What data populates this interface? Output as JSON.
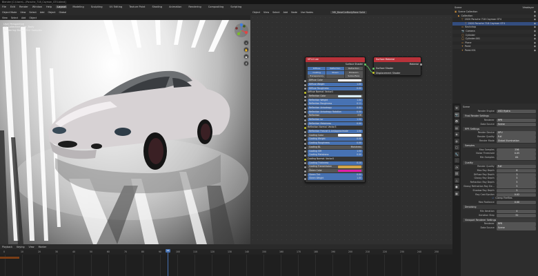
{
  "window": {
    "title": "Blender [C:\\Users\\...\\Porsche_718_Cayman_GT4.blend]"
  },
  "menu": {
    "items": [
      "File",
      "Edit",
      "Render",
      "Window",
      "Help"
    ],
    "workspaces": [
      "Layout",
      "Modeling",
      "Sculpting",
      "UV Editing",
      "Texture Paint",
      "Shading",
      "Animation",
      "Rendering",
      "Compositing",
      "Scripting"
    ],
    "active_workspace": "Layout"
  },
  "viewport": {
    "header": [
      "Object Mode",
      "View",
      "Select",
      "Add",
      "Object",
      "Global"
    ],
    "subheader": [
      "View",
      "Select",
      "Add",
      "Object"
    ],
    "info": [
      "User Perspective",
      "(0) Collection | Car_Body",
      "Rendering Done / 512 Samples"
    ],
    "gizmo_axes": [
      "X",
      "Y",
      "Z"
    ]
  },
  "node_editor": {
    "header": [
      "Object",
      "View",
      "Select",
      "Add",
      "Node",
      "Use Nodes"
    ],
    "material_name": "MK_BaseCarBodyBase Solid"
  },
  "mtlx_node": {
    "title": "MTLX Lee",
    "output": "Surface Shader",
    "btn_rows": [
      [
        "Diffuse",
        "Reflection",
        "Refraction"
      ],
      [
        "Coating",
        "Sheen",
        "Emission"
      ],
      [
        "Transparency",
        "",
        "Subsurface"
      ]
    ],
    "fields": [
      {
        "label": "Diffuse Color",
        "value": "",
        "kind": "color",
        "color": "#ffffff"
      },
      {
        "label": "Diffuse Weight",
        "value": "1.00"
      },
      {
        "label": "Diffuse Roughness",
        "value": "0.00"
      },
      {
        "label": "Diffuse Normal: Vector3",
        "value": "",
        "kind": "label"
      },
      {
        "label": "Reflection Color",
        "value": "",
        "kind": "color",
        "color": "#d9ecf5"
      },
      {
        "label": "Reflection Weight",
        "value": "1.00"
      },
      {
        "label": "Reflection Roughness",
        "value": "0.11"
      },
      {
        "label": "Reflection Anisotropy",
        "value": "0.00"
      },
      {
        "label": "Reflection Anisotropy Rotation",
        "value": "0.00"
      },
      {
        "label": "Reflection",
        "value": "IOR",
        "kind": "enum"
      },
      {
        "label": "Reflection Ior",
        "value": "1.50"
      },
      {
        "label": "Reflection Metalness",
        "value": "0.00"
      },
      {
        "label": "Reflection Normal: Vector3",
        "value": "",
        "kind": "label"
      },
      {
        "label": "Reflection Fresnel & Air/Approximate",
        "value": "1.50"
      },
      {
        "label": "Coating Color",
        "value": "",
        "kind": "color",
        "color": "#ffffff"
      },
      {
        "label": "Coating Weight",
        "value": "0.00"
      },
      {
        "label": "Coating Roughness",
        "value": "0.00"
      },
      {
        "label": "Coating BL",
        "value": "Moistness",
        "kind": "enum"
      },
      {
        "label": "Coating IOR",
        "value": "1.50"
      },
      {
        "label": "Coating Metalness",
        "value": "0.00"
      },
      {
        "label": "Coating Normal: Vector3",
        "value": "",
        "kind": "label"
      },
      {
        "label": "Coating Thickness",
        "value": "0.10"
      },
      {
        "label": "Coating Transmission Color",
        "value": "",
        "kind": "color",
        "color": "#d4a548"
      },
      {
        "label": "Sheen Color",
        "value": "",
        "kind": "color",
        "color": "#e21ca8"
      },
      {
        "label": "Sheen Tint",
        "value": "0.00"
      },
      {
        "label": "Sheen Weight",
        "value": "1.00"
      }
    ]
  },
  "surface_node": {
    "title": "Surface Material",
    "output": "Material",
    "inputs": [
      "Surface Shader",
      "Displacement Shader"
    ]
  },
  "outliner": {
    "header": [
      "Scene",
      "Viewlayer"
    ],
    "rows": [
      {
        "label": "Scene Collection",
        "depth": 0
      },
      {
        "label": "Collection",
        "depth": 1
      },
      {
        "label": "2020 Porsche 718 Cayman GT4",
        "depth": 2
      },
      {
        "label": "2020 Porsche 718 Cayman GT4",
        "depth": 3,
        "selected": true
      },
      {
        "label": "Backdrop",
        "depth": 2
      },
      {
        "label": "Camera",
        "depth": 2
      },
      {
        "label": "Cylinder",
        "depth": 2
      },
      {
        "label": "Cylinder.001",
        "depth": 2
      },
      {
        "label": "Plane",
        "depth": 2
      },
      {
        "label": "Point",
        "depth": 2
      },
      {
        "label": "Point.001",
        "depth": 2
      }
    ]
  },
  "properties": {
    "tabs": [
      "tool",
      "render",
      "output",
      "view-layer",
      "scene",
      "world",
      "object",
      "modifier",
      "particles",
      "physics",
      "constraints",
      "data",
      "material",
      "texture"
    ],
    "scene_label": "Scene",
    "render_engine": {
      "label": "Render Engine",
      "value": "USD Hydra"
    },
    "sections": [
      {
        "title": "Final Render Settings",
        "rows": [
          {
            "label": "Renderer",
            "value": "RPR"
          },
          {
            "label": "Data Source",
            "value": "Scene"
          }
        ]
      },
      {
        "title": "RPR Settings",
        "rows": [
          {
            "label": "Render Device",
            "value": "GPU"
          },
          {
            "label": "Render Quality",
            "value": "Full"
          },
          {
            "label": "Render Mode",
            "value": "Global Illumination"
          }
        ]
      },
      {
        "title": "Samples",
        "rows": [
          {
            "label": "Max Samples",
            "value": "256"
          },
          {
            "label": "Noise Threshold",
            "value": "0.05"
          },
          {
            "label": "Min Samples",
            "value": "64"
          }
        ]
      },
      {
        "title": "Quality",
        "rows": [
          {
            "label": "Render Quality",
            "value": "Full"
          },
          {
            "label": "Max Ray Depth",
            "value": "8"
          },
          {
            "label": "Diffuse Ray Depth",
            "value": "3"
          },
          {
            "label": "Glossy Ray Depth",
            "value": "5"
          },
          {
            "label": "Refraction Ray Depth",
            "value": "5"
          },
          {
            "label": "Glossy Refraction Ray De...",
            "value": "5"
          },
          {
            "label": "Shadow Ray Depth",
            "value": "5"
          },
          {
            "label": "Ray Cast Epsilon",
            "value": "0.02"
          }
        ]
      },
      {
        "title": "",
        "rows": [
          {
            "label": "Max Radiance",
            "value": "0.00"
          }
        ]
      },
      {
        "title": "Denoising",
        "rows": [
          {
            "label": "Min Iteration",
            "value": "4"
          },
          {
            "label": "Iteration Step",
            "value": "32"
          }
        ]
      },
      {
        "title": "Viewport Renderer Settings",
        "rows": [
          {
            "label": "Renderer",
            "value": "RPR"
          },
          {
            "label": "Data Source",
            "value": "Scene"
          }
        ]
      }
    ],
    "clamp_label": "Clamp Fireflies"
  },
  "timeline": {
    "header": [
      "Playback",
      "Keying",
      "View",
      "Marker"
    ],
    "current_frame": 94,
    "ticks": [
      0,
      10,
      20,
      30,
      40,
      50,
      60,
      70,
      80,
      90,
      100,
      110,
      120,
      130,
      140,
      150,
      160,
      170,
      180,
      190,
      200,
      210,
      220,
      230,
      240,
      250
    ]
  },
  "colors": {
    "accent": "#4772b3",
    "node_header": "#b8323a",
    "socket_shader": "#63c763",
    "playhead": "#4772b3"
  }
}
